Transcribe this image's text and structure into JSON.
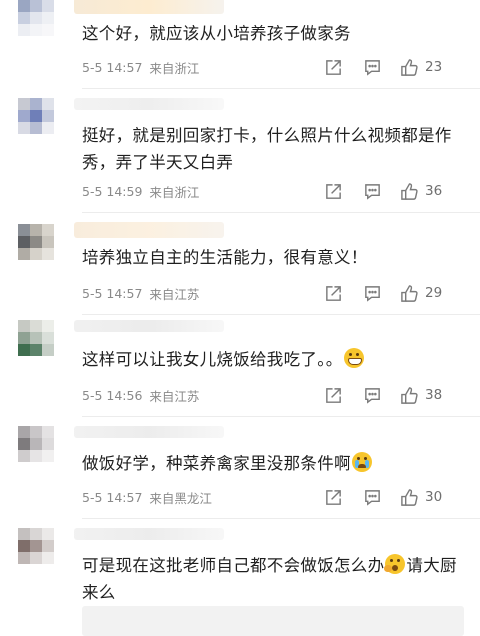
{
  "comments": [
    {
      "text": "这个好，就应该从小培养孩子做家务",
      "time": "5-5 14:57",
      "location": "来自浙江",
      "likes": "23"
    },
    {
      "text": "挺好，就是别回家打卡，什么照片什么视频都是作秀，弄了半天又白弄",
      "time": "5-5 14:59",
      "location": "来自浙江",
      "likes": "36"
    },
    {
      "text": "培养独立自主的生活能力，很有意义！",
      "time": "5-5 14:57",
      "location": "来自江苏",
      "likes": "29"
    },
    {
      "text": "这样可以让我女儿烧饭给我吃了。。",
      "emoji": "grin-emoji",
      "time": "5-5 14:56",
      "location": "来自江苏",
      "likes": "38"
    },
    {
      "text": "做饭好学，种菜养禽家里没那条件啊",
      "emoji": "crying-emoji",
      "time": "5-5 14:57",
      "location": "来自黑龙江",
      "likes": "30"
    },
    {
      "text_before": "可是现在这批老师自己都不会做饭怎么办",
      "emoji": "scared-emoji",
      "text_after": "请大厨来么"
    }
  ],
  "icons": {
    "share": "share-icon",
    "comment": "comment-icon",
    "like": "thumbs-up-icon"
  },
  "colors": {
    "text": "#1f1f1f",
    "meta": "#8a8a8a",
    "icon": "#7a7a7a",
    "divider": "#ececec"
  }
}
